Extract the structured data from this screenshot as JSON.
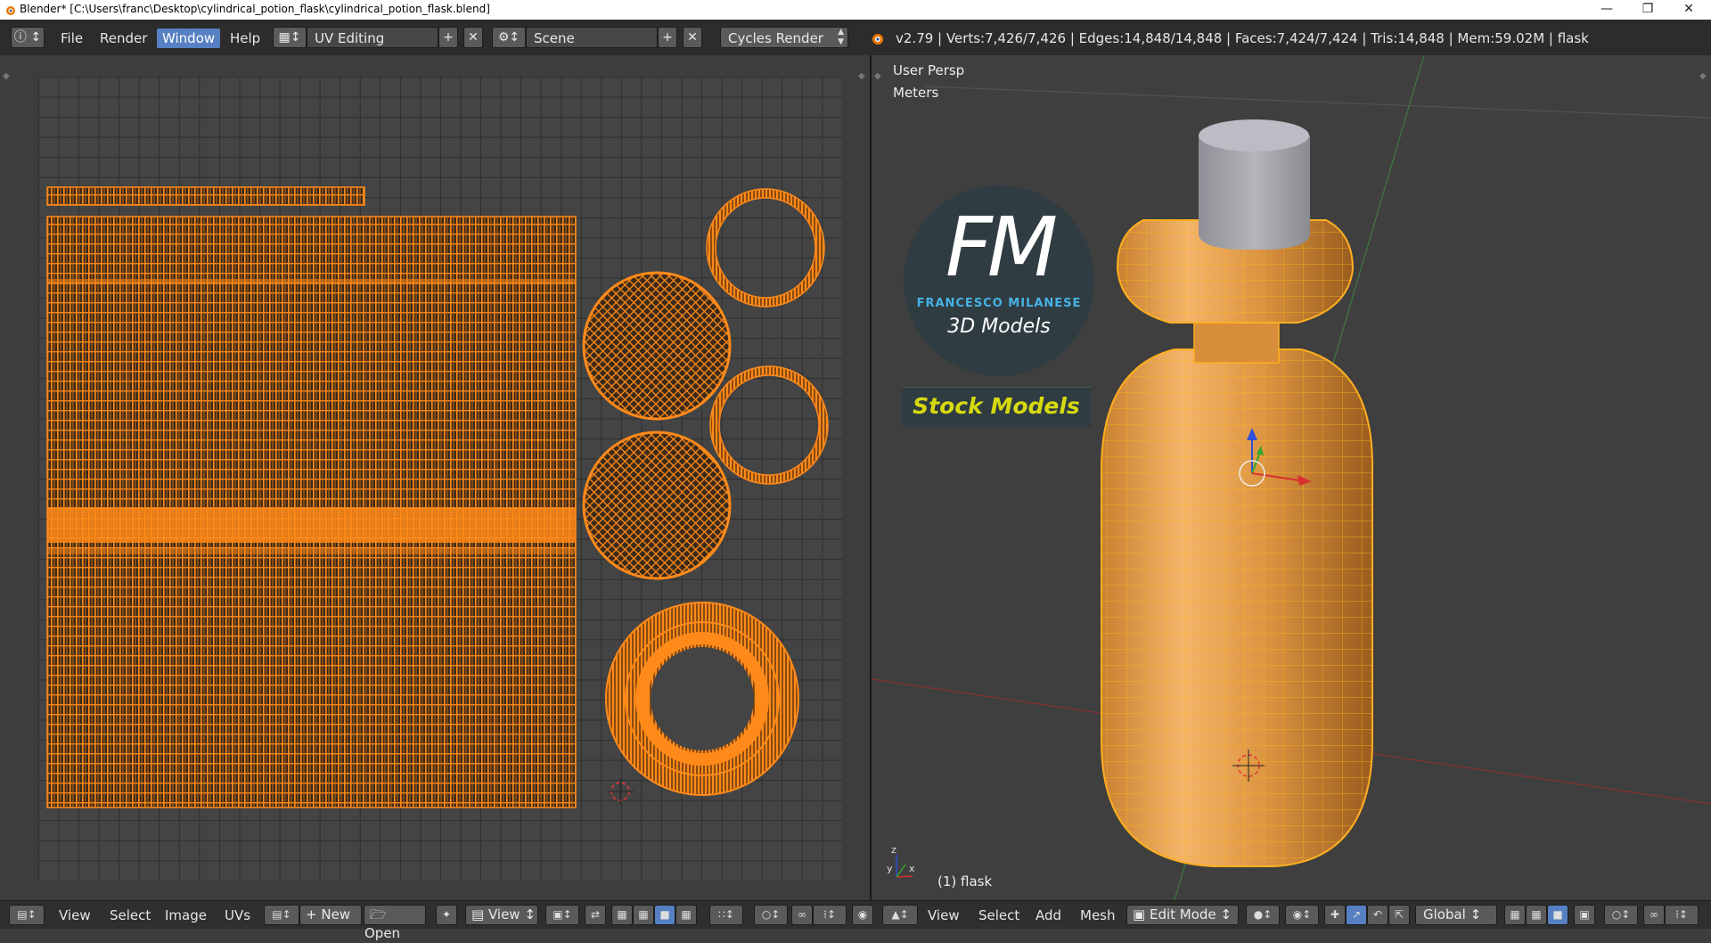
{
  "window": {
    "title": "Blender* [C:\\Users\\franc\\Desktop\\cylindrical_potion_flask\\cylindrical_potion_flask.blend]",
    "controls": [
      "minimize-icon",
      "restore-icon",
      "close-icon"
    ]
  },
  "topbar": {
    "menus": [
      "File",
      "Render",
      "Window",
      "Help"
    ],
    "active_menu": "Window",
    "screen_layout": "UV Editing",
    "scene": "Scene",
    "render_engine": "Cycles Render",
    "stats": "v2.79 | Verts:7,426/7,426 | Edges:14,848/14,848 | Faces:7,424/7,424 | Tris:14,848 | Mem:59.02M | flask"
  },
  "viewport": {
    "view_name": "User Persp",
    "units": "Meters",
    "object_label": "(1) flask",
    "watermark": {
      "initials": "FM",
      "author": "FRANCESCO MILANESE",
      "subtitle": "3D Models",
      "banner": "Stock Models"
    }
  },
  "uv_bottom": {
    "menus": [
      "View",
      "Select",
      "Image",
      "UVs"
    ],
    "new_label": "New",
    "open_label": "Open",
    "view_label": "View"
  },
  "view3d_bottom": {
    "menus": [
      "View",
      "Select",
      "Add",
      "Mesh"
    ],
    "mode": "Edit Mode",
    "orientation": "Global"
  },
  "colors": {
    "accent": "#5680c2",
    "uv_orange": "#ff8a1a",
    "mesh_orange": "#f0a030",
    "background": "#3d3d3d"
  }
}
